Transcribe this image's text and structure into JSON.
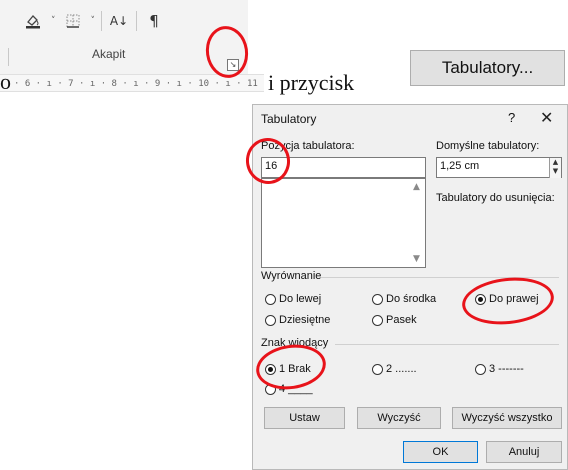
{
  "ribbon": {
    "group_label": "Akapit",
    "sort_glyph": "A↓",
    "pilcrow_glyph": "¶",
    "caret": "˅",
    "launcher_glyph": "↘",
    "icons": [
      "shading-icon",
      "borders-icon",
      "sort-icon",
      "pilcrow-icon",
      "dialog-launcher-icon"
    ]
  },
  "ruler": {
    "text": "· 6 · ı · 7 · ı · 8 · ı · 9 · ı · 10 · ı · 11"
  },
  "prose": {
    "left": "o",
    "middle": "i przycisk"
  },
  "tabulatory_button": {
    "label": "Tabulatory..."
  },
  "dialog": {
    "title": "Tabulatory",
    "help": "?",
    "close": "✕",
    "position_label": "Pozycja tabulatora:",
    "position_value": "16",
    "default_tabs_label": "Domyślne tabulatory:",
    "default_tabs_value": "1,25 cm",
    "to_clear_label": "Tabulatory do usunięcia:",
    "alignment": {
      "label": "Wyrównanie",
      "options": [
        "Do lewej",
        "Do środka",
        "Do prawej",
        "Dziesiętne",
        "Pasek"
      ],
      "selected": "Do prawej"
    },
    "leader": {
      "label": "Znak wiodący",
      "options": [
        "1 Brak",
        "2 .......",
        "3 -------",
        "4 ____"
      ],
      "selected": "1 Brak"
    },
    "buttons": {
      "set": "Ustaw",
      "clear": "Wyczyść",
      "clear_all": "Wyczyść wszystko",
      "ok": "OK",
      "cancel": "Anuluj"
    }
  },
  "colors": {
    "annotation": "#e8131a",
    "dialog_bg": "#f0f0f0",
    "button_bg": "#e1e1e1",
    "default_button_border": "#0078d7"
  }
}
